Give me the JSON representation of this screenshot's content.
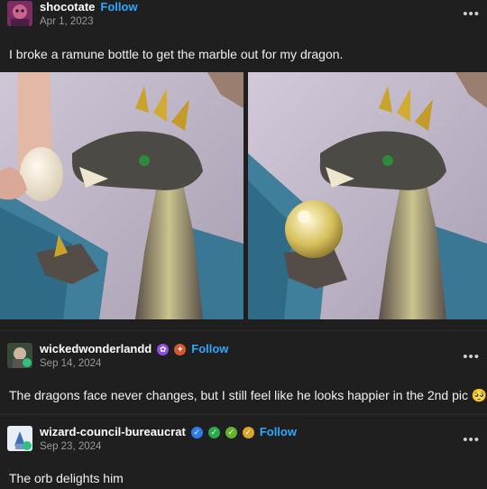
{
  "post": {
    "author": "shocotate",
    "follow_label": "Follow",
    "date": "Apr 1, 2023",
    "text": "I broke a ramune bottle to get the marble out for my dragon.",
    "menu_icon": "more-options-icon"
  },
  "replies": [
    {
      "author": "wickedwonderlandd",
      "follow_label": "Follow",
      "date": "Sep 14, 2024",
      "text": "The dragons face never changes, but I still feel like he looks happier in the 2nd pic 🥺",
      "badges": [
        "purple-flower-badge",
        "paw-badge"
      ]
    },
    {
      "author": "wizard-council-bureaucrat",
      "follow_label": "Follow",
      "date": "Sep 23, 2024",
      "text": "The orb delights him",
      "badges": [
        "blue-check-badge",
        "green-check-badge",
        "green-check-badge",
        "yellow-check-badge"
      ]
    }
  ],
  "colors": {
    "background": "#1f1f1f",
    "follow": "#2fa8ff",
    "date": "#9a9a9a"
  }
}
